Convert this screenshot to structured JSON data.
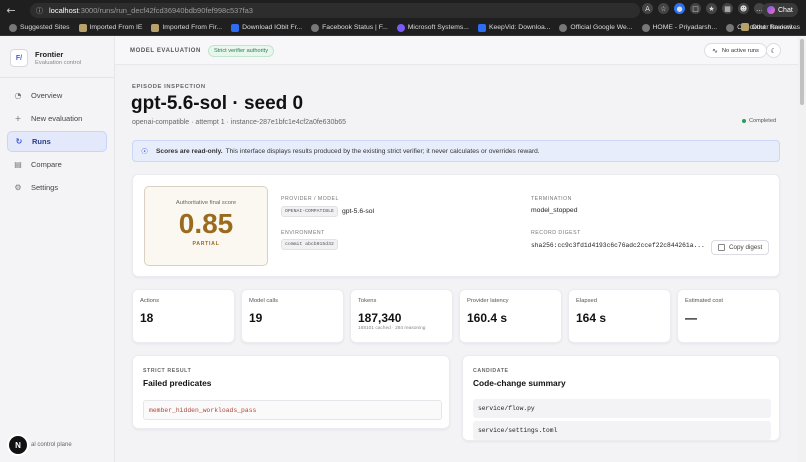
{
  "browser": {
    "url_host": "localhost",
    "url_path": ":3000/runs/run_decf42fcd36940bdb90fef998c537fa3",
    "bookmarks": [
      {
        "label": "Suggested Sites",
        "icon": "globe-icon"
      },
      {
        "label": "Imported From IE",
        "icon": "folder-icon"
      },
      {
        "label": "Imported From Fir...",
        "icon": "folder-icon"
      },
      {
        "label": "Download IObit Fr...",
        "icon": "iobit-icon"
      },
      {
        "label": "Facebook Status | F...",
        "icon": "globe-icon"
      },
      {
        "label": "Microsoft Systems...",
        "icon": "microsoft-icon"
      },
      {
        "label": "KeepVid: Downloa...",
        "icon": "keepvid-icon"
      },
      {
        "label": "Official Google We...",
        "icon": "globe-icon"
      },
      {
        "label": "HOME - Priyadarsh...",
        "icon": "globe-icon"
      },
      {
        "label": "Checkout: Review...",
        "icon": "globe-icon"
      }
    ],
    "other_favourites": "Other favourites",
    "chat_label": "Chat"
  },
  "sidebar": {
    "brand_logo": "F/",
    "brand_title": "Frontier",
    "brand_subtitle": "Evaluation control",
    "items": [
      {
        "label": "Overview",
        "icon": "overview-icon"
      },
      {
        "label": "New evaluation",
        "icon": "plus-icon"
      },
      {
        "label": "Runs",
        "icon": "runs-icon"
      },
      {
        "label": "Compare",
        "icon": "chart-icon"
      },
      {
        "label": "Settings",
        "icon": "gear-icon"
      }
    ],
    "footer_badge": "N",
    "footer_text": "al control plane"
  },
  "topbar": {
    "title": "MODEL EVALUATION",
    "badge": "Strict verifier authority",
    "runs_pill": "No active runs"
  },
  "episode": {
    "label": "EPISODE INSPECTION",
    "title": "gpt-5.6-sol · seed 0",
    "subtitle": "openai-compatible · attempt 1 · instance-287e1bfc1e4cf2a0fe630b65",
    "status": "Completed"
  },
  "notice": {
    "bold": "Scores are read-only.",
    "text": "This interface displays results produced by the existing strict verifier; it never calculates or overrides reward."
  },
  "score": {
    "label": "Authoritative final score",
    "value": "0.85",
    "tag": "PARTIAL",
    "provider_label": "PROVIDER / MODEL",
    "provider_chip": "OPENAI-COMPATIBLE",
    "model": "gpt-5.6-sol",
    "environment_label": "ENVIRONMENT",
    "environment_chip": "commit abcb015d32",
    "termination_label": "TERMINATION",
    "termination": "model_stopped",
    "digest_label": "RECORD DIGEST",
    "digest": "sha256:cc9c3fd1d4193c6c76adc2ccef22c844261a...",
    "copy_label": "Copy digest"
  },
  "metrics": [
    {
      "label": "Actions",
      "value": "18",
      "sub": ""
    },
    {
      "label": "Model calls",
      "value": "19",
      "sub": ""
    },
    {
      "label": "Tokens",
      "value": "187,340",
      "sub": "168101 cached · 284 reasoning"
    },
    {
      "label": "Provider latency",
      "value": "160.4 s",
      "sub": ""
    },
    {
      "label": "Elapsed",
      "value": "164 s",
      "sub": ""
    },
    {
      "label": "Estimated cost",
      "value": "—",
      "sub": ""
    }
  ],
  "strict_result": {
    "label": "STRICT RESULT",
    "title": "Failed predicates",
    "predicates": [
      "member_hidden_workloads_pass"
    ]
  },
  "candidate": {
    "label": "CANDIDATE",
    "title": "Code-change summary",
    "files": [
      "service/flow.py",
      "service/settings.toml"
    ]
  },
  "colors": {
    "accent": "#3a55d0",
    "score": "#9a6b1f",
    "predicate": "#b2453b",
    "status_ok": "#2e9b5a"
  }
}
